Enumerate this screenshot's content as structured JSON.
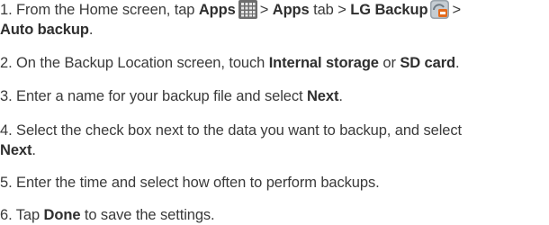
{
  "steps": [
    {
      "number": "1.",
      "t1": "From the Home screen, tap",
      "b1": "Apps",
      "icon1": "apps-grid-icon",
      "t2": "> ",
      "b2": "Apps",
      "t3": "tab > ",
      "b3": "LG Backup",
      "icon2": "lg-backup-icon",
      "t4": ">",
      "b4": "Auto backup",
      "t5": "."
    },
    {
      "number": "2.",
      "t1": "On the Backup Location screen, touch",
      "b1": "Internal storage",
      "t2": "or",
      "b2": "SD card",
      "t3": "."
    },
    {
      "number": "3.",
      "t1": "Enter a name for your backup file and select",
      "b1": "Next",
      "t2": "."
    },
    {
      "number": "4.",
      "t1": "Select the check box next to the data you want to backup, and select",
      "b1": "Next",
      "t2": "."
    },
    {
      "number": "5.",
      "t1": "Enter the time and select how often to perform backups."
    },
    {
      "number": "6.",
      "t1": "Tap",
      "b1": "Done",
      "t2": "to save the settings."
    }
  ]
}
